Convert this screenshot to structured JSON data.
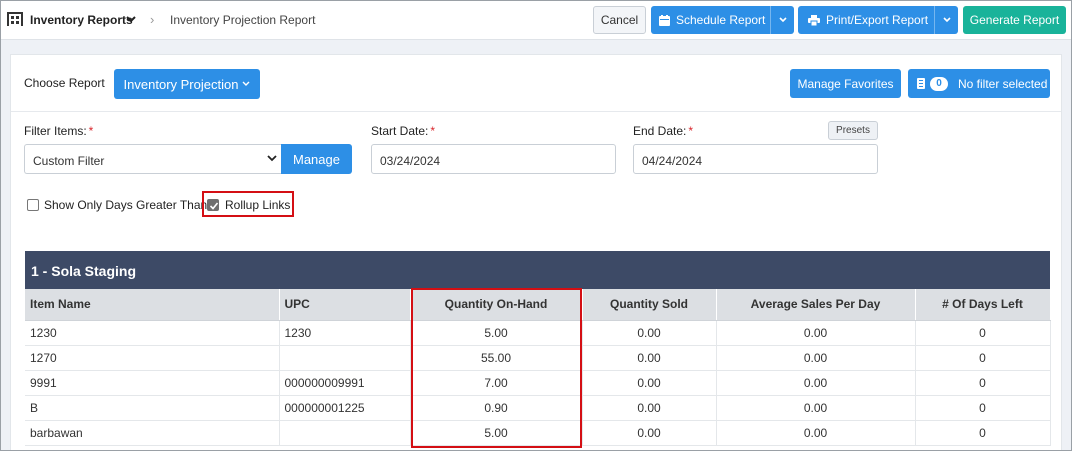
{
  "breadcrumb": {
    "root": "Inventory Reports",
    "current": "Inventory Projection Report",
    "separator": "›"
  },
  "toolbar": {
    "cancel": "Cancel",
    "schedule": "Schedule Report",
    "print_export": "Print/Export Report",
    "generate": "Generate Report"
  },
  "report_header": {
    "choose_label": "Choose Report",
    "selected_report": "Inventory Projection",
    "manage_favorites": "Manage Favorites",
    "filter_count": "0",
    "filter_status": "No filter selected"
  },
  "filters": {
    "filter_items_label": "Filter Items:",
    "required_mark": "*",
    "filter_items_value": "Custom Filter",
    "manage": "Manage",
    "start_date_label": "Start Date:",
    "start_date": "03/24/2024",
    "end_date_label": "End Date:",
    "end_date": "04/24/2024",
    "presets": "Presets"
  },
  "options": {
    "show_only_days": {
      "label": "Show Only Days Greater Than",
      "checked": false
    },
    "rollup_links": {
      "label": "Rollup Links",
      "checked": true
    }
  },
  "table": {
    "section_title": "1 - Sola Staging",
    "columns": [
      "Item Name",
      "UPC",
      "Quantity On-Hand",
      "Quantity Sold",
      "Average Sales Per Day",
      "# Of Days Left"
    ],
    "rows": [
      [
        "1230",
        "1230",
        "5.00",
        "0.00",
        "0.00",
        "0"
      ],
      [
        "1270",
        "",
        "55.00",
        "0.00",
        "0.00",
        "0"
      ],
      [
        "9991",
        "000000009991",
        "7.00",
        "0.00",
        "0.00",
        "0"
      ],
      [
        "B",
        "000000001225",
        "0.90",
        "0.00",
        "0.00",
        "0"
      ],
      [
        "barbawan",
        "",
        "5.00",
        "0.00",
        "0.00",
        "0"
      ]
    ]
  },
  "colors": {
    "primary": "#2d8fe6",
    "success": "#19b39a",
    "table_header": "#3d4a66",
    "highlight": "#d40f14"
  }
}
